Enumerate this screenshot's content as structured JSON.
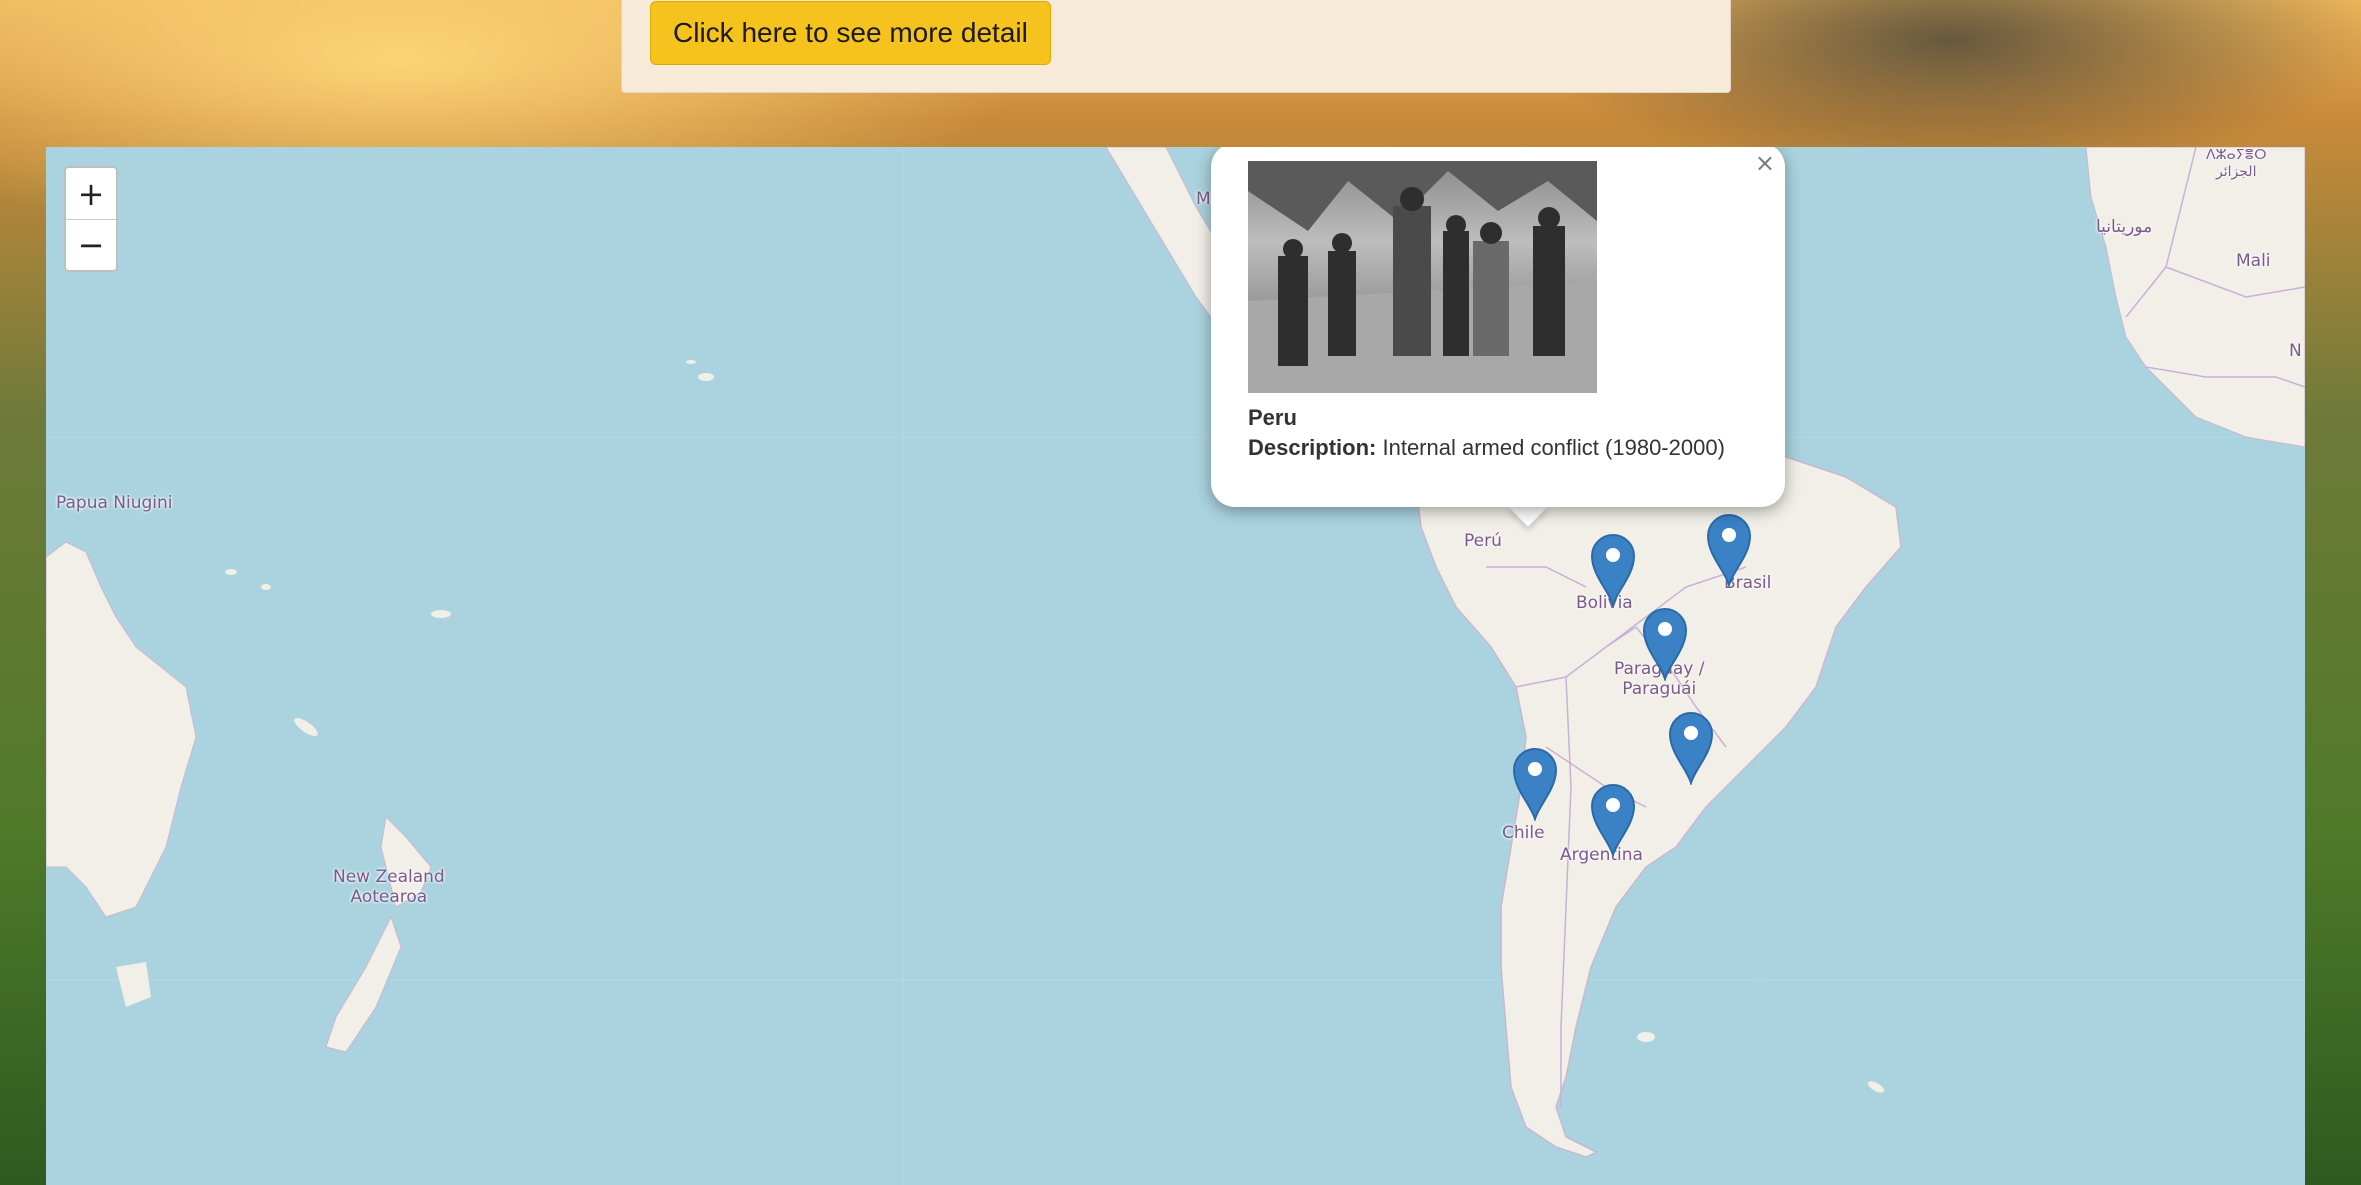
{
  "header": {
    "detail_button_label": "Click here to see more detail"
  },
  "map": {
    "zoom_in_label": "+",
    "zoom_out_label": "−",
    "labels": {
      "papua": "Papua Niugini",
      "new_zealand_1": "New Zealand",
      "new_zealand_2": "Aotearoa",
      "peru": "Perú",
      "bolivia": "Bolivia",
      "brasil": "Brasil",
      "paraguay_1": "Paraguay /",
      "paraguay_2": "Paraguái",
      "chile": "Chile",
      "argentina": "Argentina",
      "mauritania": "موريتانيا",
      "algeria_1": "ⴷⵣⴰⵢⴻⵔ",
      "algeria_2": "الجزائر",
      "mali": "Mali",
      "edge_m": "M",
      "edge_n": "N"
    },
    "marker_color": "#3a81c6"
  },
  "popup": {
    "close_label": "×",
    "title": "Peru",
    "description_label": "Description:",
    "description_value": "Internal armed conflict (1980-2000)"
  }
}
